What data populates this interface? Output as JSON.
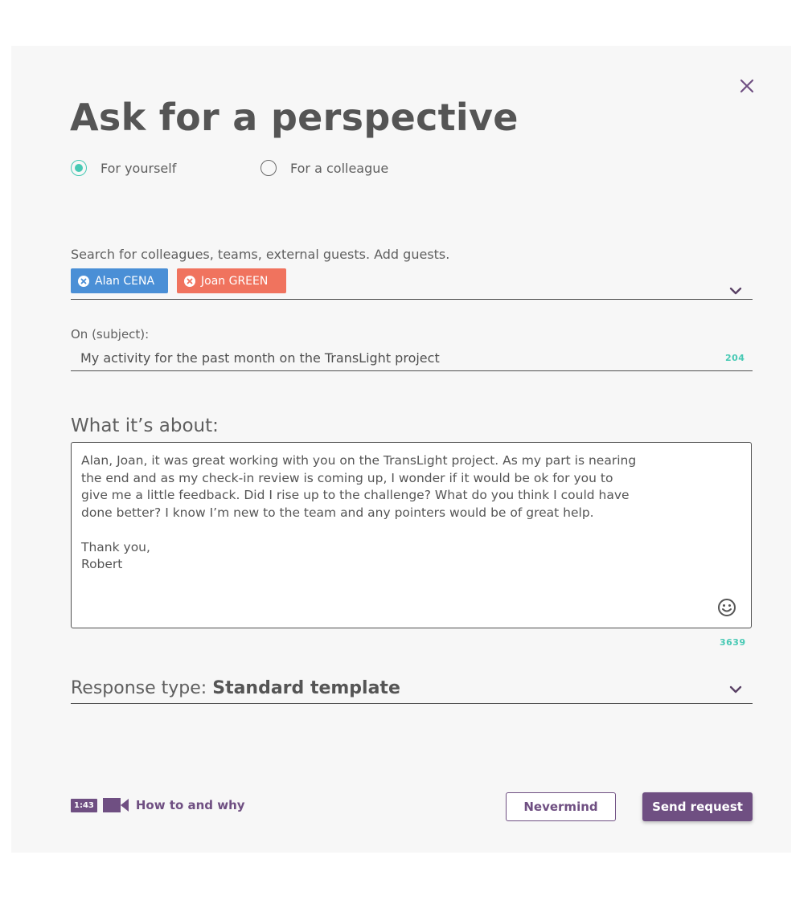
{
  "dialog": {
    "title": "Ask for a perspective",
    "close_icon": "close-icon"
  },
  "target": {
    "options": [
      {
        "label": "For yourself",
        "checked": true
      },
      {
        "label": "For a colleague",
        "checked": false
      }
    ]
  },
  "recipients": {
    "label": "Search for colleagues, teams, external guests. Add guests.",
    "chips": [
      {
        "label": "Alan CENA",
        "color": "#4a8fd6"
      },
      {
        "label": "Joan GREEN",
        "color": "#f0735e"
      }
    ]
  },
  "subject": {
    "label": "On (subject):",
    "value": "My activity for the past month on the TransLight project",
    "remaining": "204"
  },
  "about": {
    "label": "What it’s about:",
    "body": "Alan, Joan, it was great working with you on the TransLight project. As my part is nearing\nthe end and as my check-in review is coming up, I wonder if it would be ok for you to\ngive me a little feedback. Did I rise up to the challenge? What do you think I could have\ndone better? I know I’m new to the team and any pointers would be of great help.\n\nThank you,\nRobert",
    "remaining": "3639",
    "emoji_icon": "smiley-icon"
  },
  "response": {
    "prefix": "Response type: ",
    "value": "Standard template"
  },
  "footer": {
    "duration": "1:43",
    "help_label": "How to and why",
    "cancel_label": "Nevermind",
    "submit_label": "Send request"
  },
  "colors": {
    "accent": "#6f4f82",
    "teal": "#47c9b4"
  }
}
